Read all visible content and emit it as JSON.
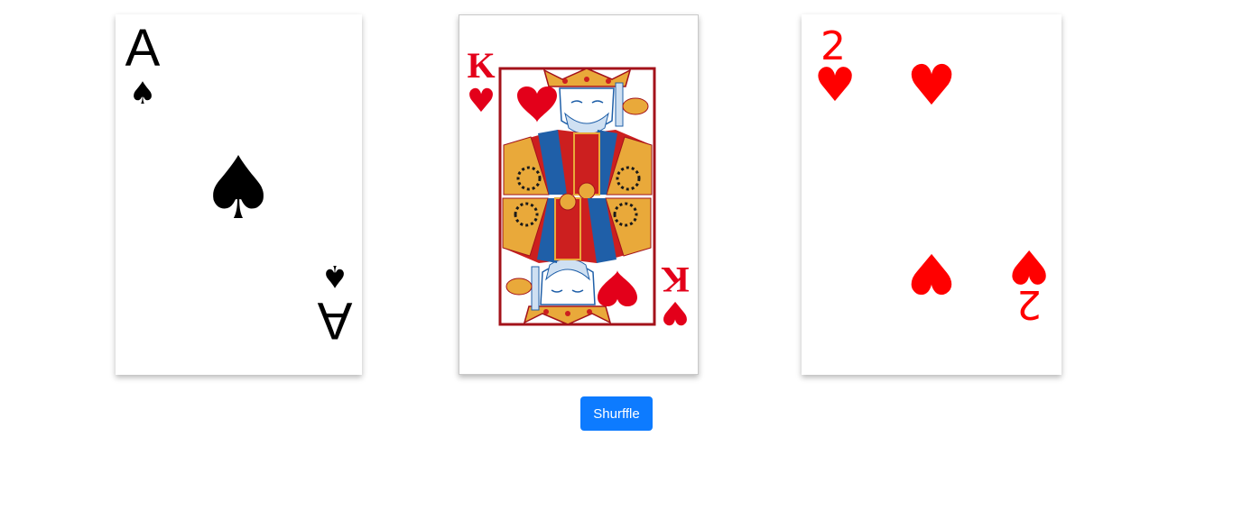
{
  "cards": [
    {
      "rank": "A",
      "suit": "spades",
      "suit_symbol": "♠",
      "color": "#000000"
    },
    {
      "rank": "K",
      "suit": "hearts",
      "suit_symbol": "♥",
      "color": "#e3001a",
      "face_colors": {
        "red": "#cc1f1f",
        "blue": "#1f5fa8",
        "gold": "#e9a93a",
        "border": "#a3121a"
      }
    },
    {
      "rank": "2",
      "suit": "hearts",
      "suit_symbol": "♥",
      "color": "#ff0000"
    }
  ],
  "controls": {
    "shuffle_label": "Shurffle",
    "shuffle_color": "#0d7bff"
  }
}
